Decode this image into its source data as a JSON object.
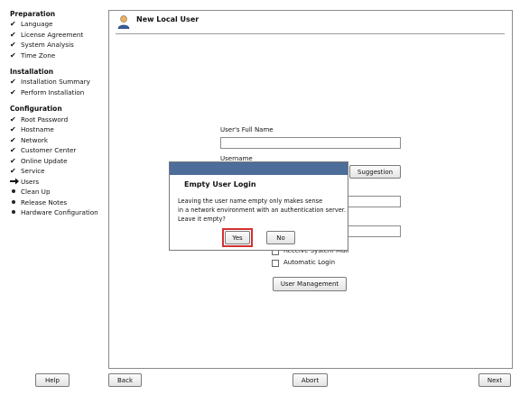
{
  "sidebar": {
    "preparation": {
      "title": "Preparation",
      "items": [
        {
          "label": "Language",
          "state": "done"
        },
        {
          "label": "License Agreement",
          "state": "done"
        },
        {
          "label": "System Analysis",
          "state": "done"
        },
        {
          "label": "Time Zone",
          "state": "done"
        }
      ]
    },
    "installation": {
      "title": "Installation",
      "items": [
        {
          "label": "Installation Summary",
          "state": "done"
        },
        {
          "label": "Perform Installation",
          "state": "done"
        }
      ]
    },
    "configuration": {
      "title": "Configuration",
      "items": [
        {
          "label": "Root Password",
          "state": "done"
        },
        {
          "label": "Hostname",
          "state": "done"
        },
        {
          "label": "Network",
          "state": "done"
        },
        {
          "label": "Customer Center",
          "state": "done"
        },
        {
          "label": "Online Update",
          "state": "done"
        },
        {
          "label": "Service",
          "state": "done"
        },
        {
          "label": "Users",
          "state": "current"
        },
        {
          "label": "Clean Up",
          "state": "pending"
        },
        {
          "label": "Release Notes",
          "state": "pending"
        },
        {
          "label": "Hardware Configuration",
          "state": "pending"
        }
      ]
    }
  },
  "page": {
    "title": "New Local User",
    "icon": "user-icon",
    "full_name_label": "User's Full Name",
    "full_name_value": "",
    "username_label": "Username",
    "username_value": "",
    "suggestion_button": "Suggestion",
    "receive_mail_label": "Receive System Mail",
    "automatic_login_label": "Automatic Login",
    "user_management_button": "User Management"
  },
  "dialog": {
    "title": "Empty User Login",
    "message_lines": [
      "Leaving the user name empty only makes sense",
      "in a network environment with an authentication server.",
      "Leave it empty?"
    ],
    "yes_button": "Yes",
    "no_button": "No"
  },
  "footer": {
    "help_button": "Help",
    "back_button": "Back",
    "abort_button": "Abort",
    "next_button": "Next"
  },
  "colors": {
    "dialog_titlebar": "#4d6d9a",
    "focus_highlight": "#d43030"
  }
}
